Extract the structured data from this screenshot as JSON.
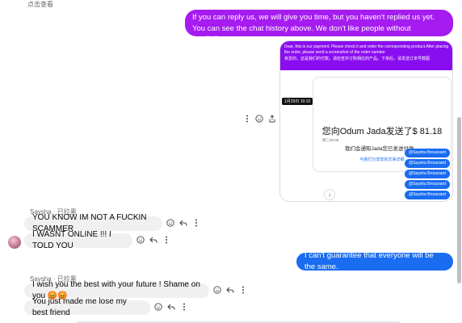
{
  "header": {
    "top_link": "点击查看"
  },
  "messages": {
    "outgoing_1": "If you can reply us, we will give you time, but you haven't replied us yet. You can see the chat history above. We don't like people without credibility.",
    "outgoing_2": "I can't guarantee that everyone will be the same."
  },
  "screenshot": {
    "banner_en": "Dear, this is our payment. Please check it and order the corresponding product.After placing the order, please send a screenshot of the order number",
    "banner_cn": "亲爱的，这是我们的付款。请检查并订购相应的产品。下单后，请发送订单号截图",
    "timestamp_1": "1月29日 10:10",
    "amount_line": "您向Odum Jada发送了$ 81.18",
    "sub_line": "我们会通知Jada您已发送付款。",
    "link_line": "与我们分享您的交易详细",
    "timestamp_2": "周二20:06",
    "tags": [
      "@Saysha Broussard",
      "@Saysha Broussard",
      "@Saysha Broussard",
      "@Saysha Broussard",
      "@Saysha Broussard"
    ]
  },
  "group_1": {
    "sender": "Saysha · 已拉黑",
    "msg_1": "YOU KNOW IM NOT A FUCKIN SCAMMER",
    "msg_2": "I WASNT ONLINE !!! I TOLD YOU"
  },
  "group_2": {
    "sender": "Saysha · 已拉黑",
    "msg_1": "I wish you the best with your future ! Shame on you 😡😡",
    "msg_2": "You just made me lose my best friend"
  },
  "colors": {
    "purple_bubble": "#a51bf0",
    "blue_bubble": "#1a6cf0",
    "incoming_bubble": "#f0f0f0"
  },
  "icons": [
    "more-icon",
    "emoji-icon",
    "share-icon",
    "reply-icon",
    "down-arrow-icon"
  ]
}
